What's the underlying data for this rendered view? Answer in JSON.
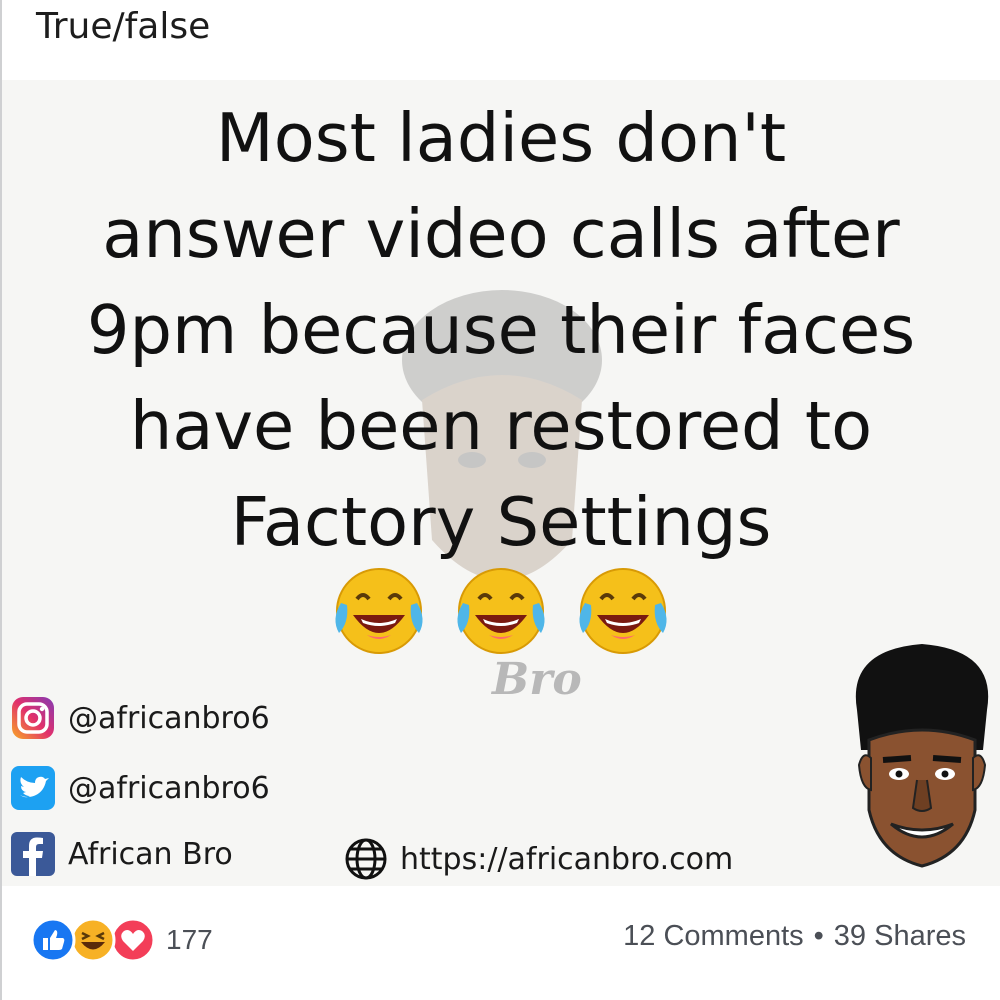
{
  "post": {
    "caption": "True/false"
  },
  "meme": {
    "lines": [
      "Most ladies don't",
      "answer video calls after",
      "9pm because their faces",
      "have been restored to",
      "Factory Settings"
    ],
    "emojis": [
      "laughing-crying-emoji",
      "laughing-crying-emoji",
      "laughing-crying-emoji"
    ],
    "watermark": "Bro",
    "socials": {
      "instagram": "@africanbro6",
      "twitter": "@africanbro6",
      "facebook": "African Bro",
      "website": "https://africanbro.com"
    }
  },
  "footer": {
    "reaction_count": "177",
    "comments": "12 Comments",
    "separator": "•",
    "shares": "39 Shares",
    "reaction_icons": [
      "like-icon",
      "haha-icon",
      "love-icon"
    ]
  },
  "colors": {
    "like": "#1877f2",
    "love": "#f33e58",
    "haha": "#f7b125",
    "instagram": "#c13584",
    "twitter": "#1da1f2",
    "facebook": "#3b5998"
  }
}
